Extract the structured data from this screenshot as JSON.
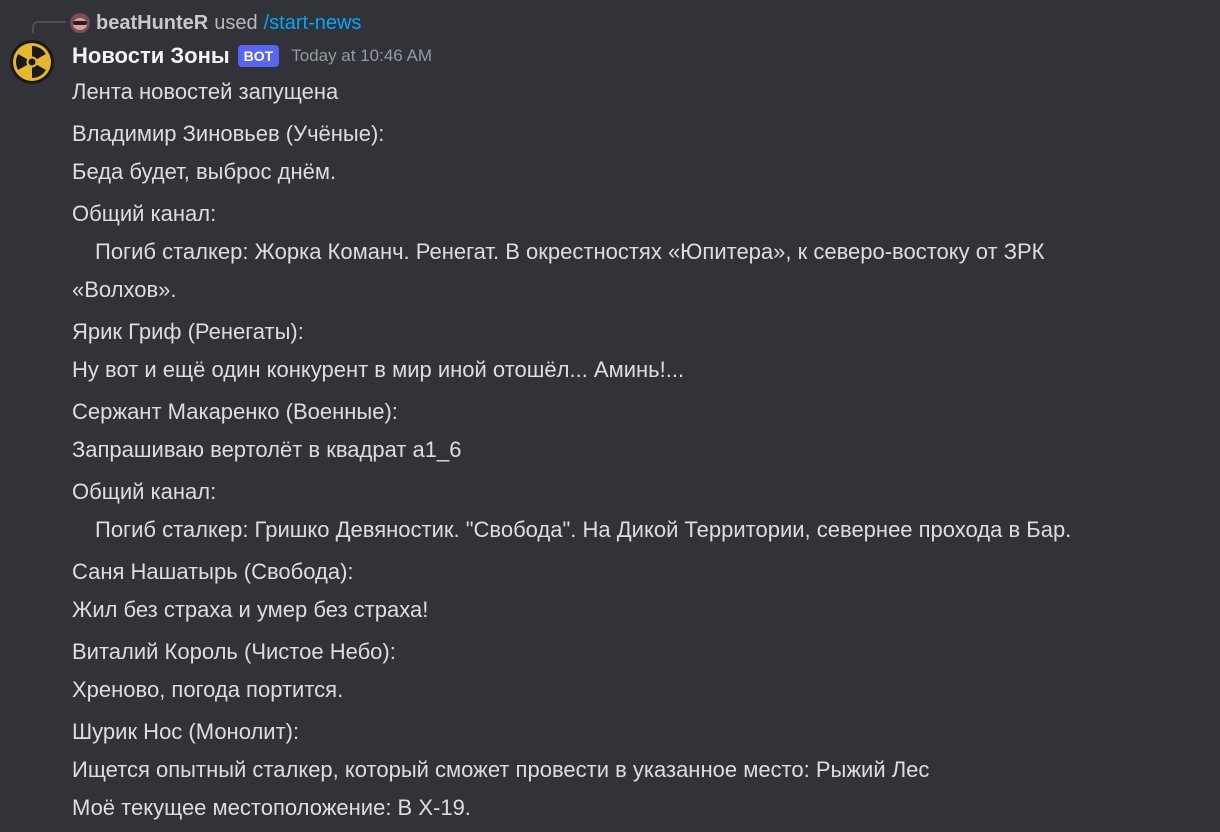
{
  "interaction": {
    "user": "beatHunteR",
    "used_text": "used",
    "command": "/start-news",
    "user_avatar_icon": "user-avatar-sunglasses"
  },
  "bot": {
    "name": "Новости Зоны",
    "tag": "BOT",
    "timestamp": "Today at 10:46 AM",
    "avatar_icon": "radiation-symbol-icon",
    "tag_color": "#5865f2"
  },
  "lines": [
    {
      "text": "Лента новостей запущена"
    },
    {
      "text": "Владимир Зиновьев (Учёные):"
    },
    {
      "text": "Беда будет, выброс днём."
    },
    {
      "text": "Общий канал:"
    },
    {
      "text": "Погиб сталкер: Жорка Команч. Ренегат. В окрестностях «Юпитера», к северо-востоку от ЗРК"
    },
    {
      "text": "«Волхов»."
    },
    {
      "text": "Ярик Гриф (Ренегаты):"
    },
    {
      "text": "Ну вот и ещё один конкурент в мир иной отошёл... Аминь!..."
    },
    {
      "text": "Сержант Макаренко (Военные):"
    },
    {
      "text": "Запрашиваю вертолёт в квадрат а1_6"
    },
    {
      "text": "Общий канал:"
    },
    {
      "text": "Погиб сталкер: Гришко Девяностик. \"Свобода\". На Дикой Территории, севернее прохода в Бар."
    },
    {
      "text": "Саня Нашатырь (Свобода):"
    },
    {
      "text": "Жил без страха и умер без страха!"
    },
    {
      "text": "Виталий Король (Чистое Небо):"
    },
    {
      "text": "Хреново, погода портится."
    },
    {
      "text": "Шурик Нос (Монолит):"
    },
    {
      "text": "Ищется опытный сталкер, который сможет провести в указанное место: Рыжий Лес"
    },
    {
      "text": "Моё текущее местоположение: В X-19."
    }
  ]
}
